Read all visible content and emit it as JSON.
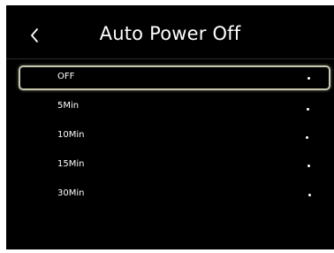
{
  "header": {
    "back_icon": "chevron-left-icon",
    "title": "Auto Power Off"
  },
  "options": [
    {
      "label": "OFF",
      "selected": true
    },
    {
      "label": "5Min",
      "selected": false
    },
    {
      "label": "10Min",
      "selected": false
    },
    {
      "label": "15Min",
      "selected": false
    },
    {
      "label": "30Min",
      "selected": false
    }
  ],
  "colors": {
    "background": "#000000",
    "text": "#ffffff",
    "selection_border": "#c8c9b0"
  }
}
